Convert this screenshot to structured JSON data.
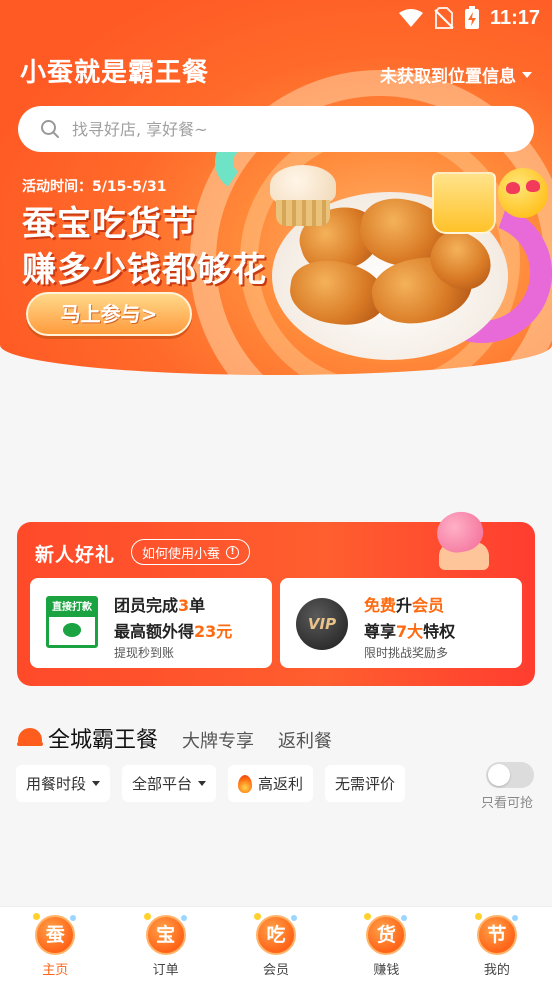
{
  "status_bar": {
    "time": "11:17",
    "icons": [
      "wifi-icon",
      "no-sim-icon",
      "battery-charging-icon"
    ]
  },
  "header": {
    "app_title": "小蚕就是霸王餐",
    "location": "未获取到位置信息"
  },
  "search": {
    "placeholder": "找寻好店, 享好餐~"
  },
  "banner": {
    "activity_time": "活动时间：5/15-5/31",
    "headline_1": "蚕宝吃货节",
    "headline_2": "赚多少钱都够花",
    "cta": "马上参与>"
  },
  "new_user": {
    "title": "新人好礼",
    "how_to": "如何使用小蚕",
    "offers": [
      {
        "icon_label": "直接打款",
        "line1_a": "团员完成",
        "line1_hl": "3",
        "line1_b": "单",
        "line2_a": "最高额外得",
        "line2_hl": "23元",
        "sub": "提现秒到账"
      },
      {
        "icon_label": "VIP",
        "line1_hl": "免费",
        "line1_b": "升",
        "line1_hl2": "会员",
        "line2_a": "尊享",
        "line2_hl": "7大",
        "line2_b": "特权",
        "sub": "限时挑战奖励多"
      }
    ]
  },
  "category_tabs": {
    "main": "全城霸王餐",
    "tab2": "大牌专享",
    "tab3": "返利餐"
  },
  "filters": {
    "meal_time": "用餐时段",
    "platform": "全部平台",
    "high_rebate": "高返利",
    "no_review": "无需评价",
    "toggle_label": "只看可抢"
  },
  "bottom_nav": [
    {
      "icon_char": "蚕",
      "label": "主页",
      "active": true
    },
    {
      "icon_char": "宝",
      "label": "订单"
    },
    {
      "icon_char": "吃",
      "label": "会员"
    },
    {
      "icon_char": "货",
      "label": "赚钱"
    },
    {
      "icon_char": "节",
      "label": "我的"
    }
  ],
  "colors": {
    "brand_orange": "#ff6418",
    "highlight": "#ff6a10",
    "wechat_green": "#1aa340"
  }
}
